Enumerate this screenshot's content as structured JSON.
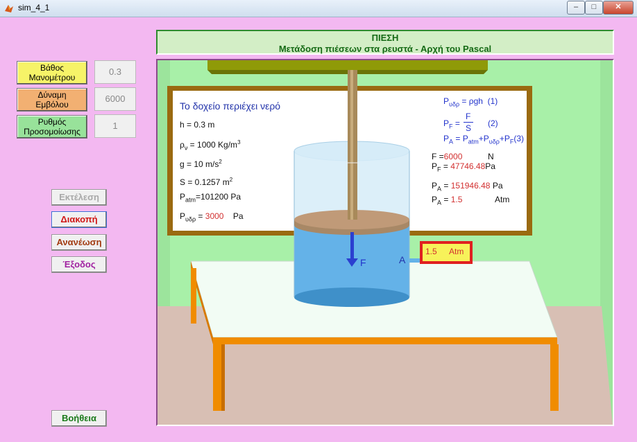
{
  "window": {
    "title": "sim_4_1",
    "minimize": "–",
    "maximize": "□",
    "close": "✕"
  },
  "controls": [
    {
      "label_line1": "Βάθος",
      "label_line2": "Μανομέτρου",
      "value": "0.3",
      "color": "#f6f368"
    },
    {
      "label_line1": "Δύναμη",
      "label_line2": "Εμβόλου",
      "value": "6000",
      "color": "#f2b072"
    },
    {
      "label_line1": "Ρυθμός",
      "label_line2": "Προσομοίωσης",
      "value": "1",
      "color": "#98e29a"
    }
  ],
  "buttons": {
    "run": "Εκτέλεση",
    "stop": "Διακοπή",
    "refresh": "Ανανέωση",
    "exit": "Έξοδος",
    "help": "Βοήθεια"
  },
  "header": {
    "line1": "ΠΙΕΣΗ",
    "line2": "Μετάδοση πιέσεων στα ρευστά - Αρχή του Pascal"
  },
  "board": {
    "title": "Το δοχείο περιέχει νερό",
    "h_label": "h =",
    "h_value": "0.3",
    "h_unit": "m",
    "rho_label": "ρ",
    "rho_sub": "ν",
    "rho_value": "= 1000 Kg/m",
    "rho_exp": "3",
    "g_label": "g = 10 m/s",
    "g_exp": "2",
    "s_label": "S = 0.1257 m",
    "s_exp": "2",
    "patm_label": "P",
    "patm_sub": "atm",
    "patm_value": "=101200 Pa",
    "pydr_label": "P",
    "pydr_sub": "υδρ",
    "pydr_eq": "=",
    "pydr_value": "3000",
    "pydr_unit": "Pa",
    "f1_lhs": "P",
    "f1_sub": "υδρ",
    "f1_rhs": "= ρgh",
    "f1_num": "(1)",
    "f2_lhs": "P",
    "f2_sub": "F",
    "f2_eq": "=",
    "f2_num_top": "F",
    "f2_num_bot": "S",
    "f2_num": "(2)",
    "f3_text_1": "P",
    "f3_sub_a": "A",
    "f3_text_2": "= P",
    "f3_sub_atm": "atm",
    "f3_text_3": "+P",
    "f3_sub_ydr": "υδρ",
    "f3_text_4": "+P",
    "f3_sub_f": "F",
    "f3_num": "(3)",
    "force_label": "F =",
    "force_value": "6000",
    "force_unit": "N",
    "pf_label": "P",
    "pf_sub": "F",
    "pf_eq": "=",
    "pf_value": "47746.48",
    "pf_unit": "Pa",
    "pa_label": "P",
    "pa_sub": "A",
    "pa_eq": "=",
    "pa_value": "151946.48",
    "pa_unit": "Pa",
    "pa2_label": "P",
    "pa2_sub": "A",
    "pa2_eq": "=",
    "pa2_value": "1.5",
    "pa2_unit": "Atm"
  },
  "scene": {
    "force_arrow_label": "F",
    "point_label": "A",
    "gauge_value": "1.5",
    "gauge_unit": "Atm"
  },
  "colors": {
    "background": "#f3b8f1",
    "water": "#64b2e8",
    "piston": "#c09a78",
    "table": "#f2fcf4",
    "table_legs": "#ef8a00",
    "board_frame": "#9a6a10",
    "wall": "#a8f0a8",
    "gauge_border": "#e02020",
    "gauge_fill": "#f7f25a"
  }
}
